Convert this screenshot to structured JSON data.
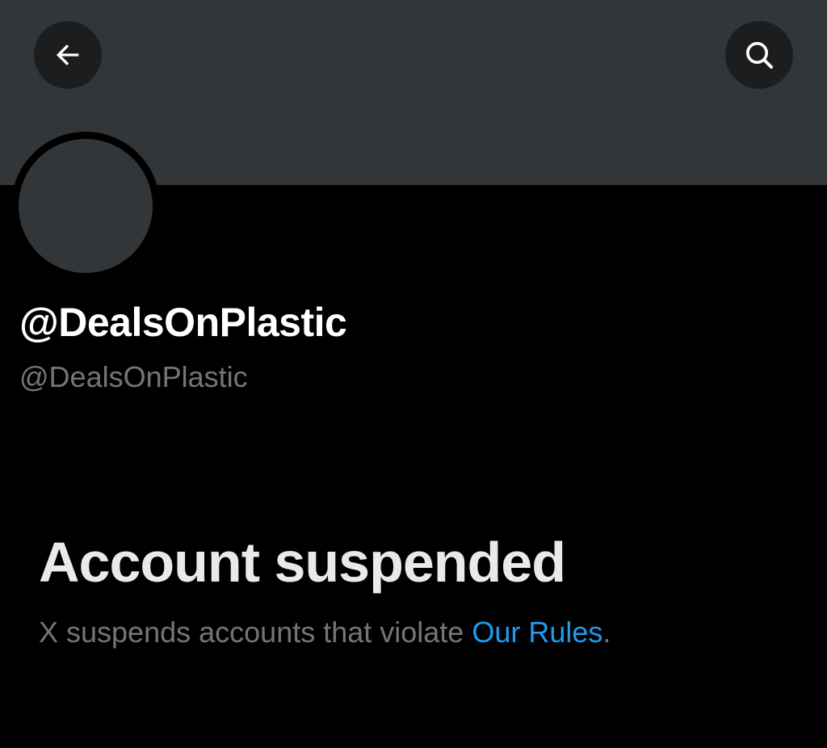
{
  "profile": {
    "display_name": "@DealsOnPlastic",
    "handle": "@DealsOnPlastic"
  },
  "header": {
    "back_icon": "arrow-left-icon",
    "search_icon": "search-icon"
  },
  "suspension": {
    "title": "Account suspended",
    "message_prefix": "X suspends accounts that violate ",
    "rules_link": "Our Rules",
    "message_suffix": "."
  },
  "colors": {
    "background": "#000000",
    "banner": "#333639",
    "link": "#1d9bf0",
    "secondary_text": "#71767b"
  }
}
